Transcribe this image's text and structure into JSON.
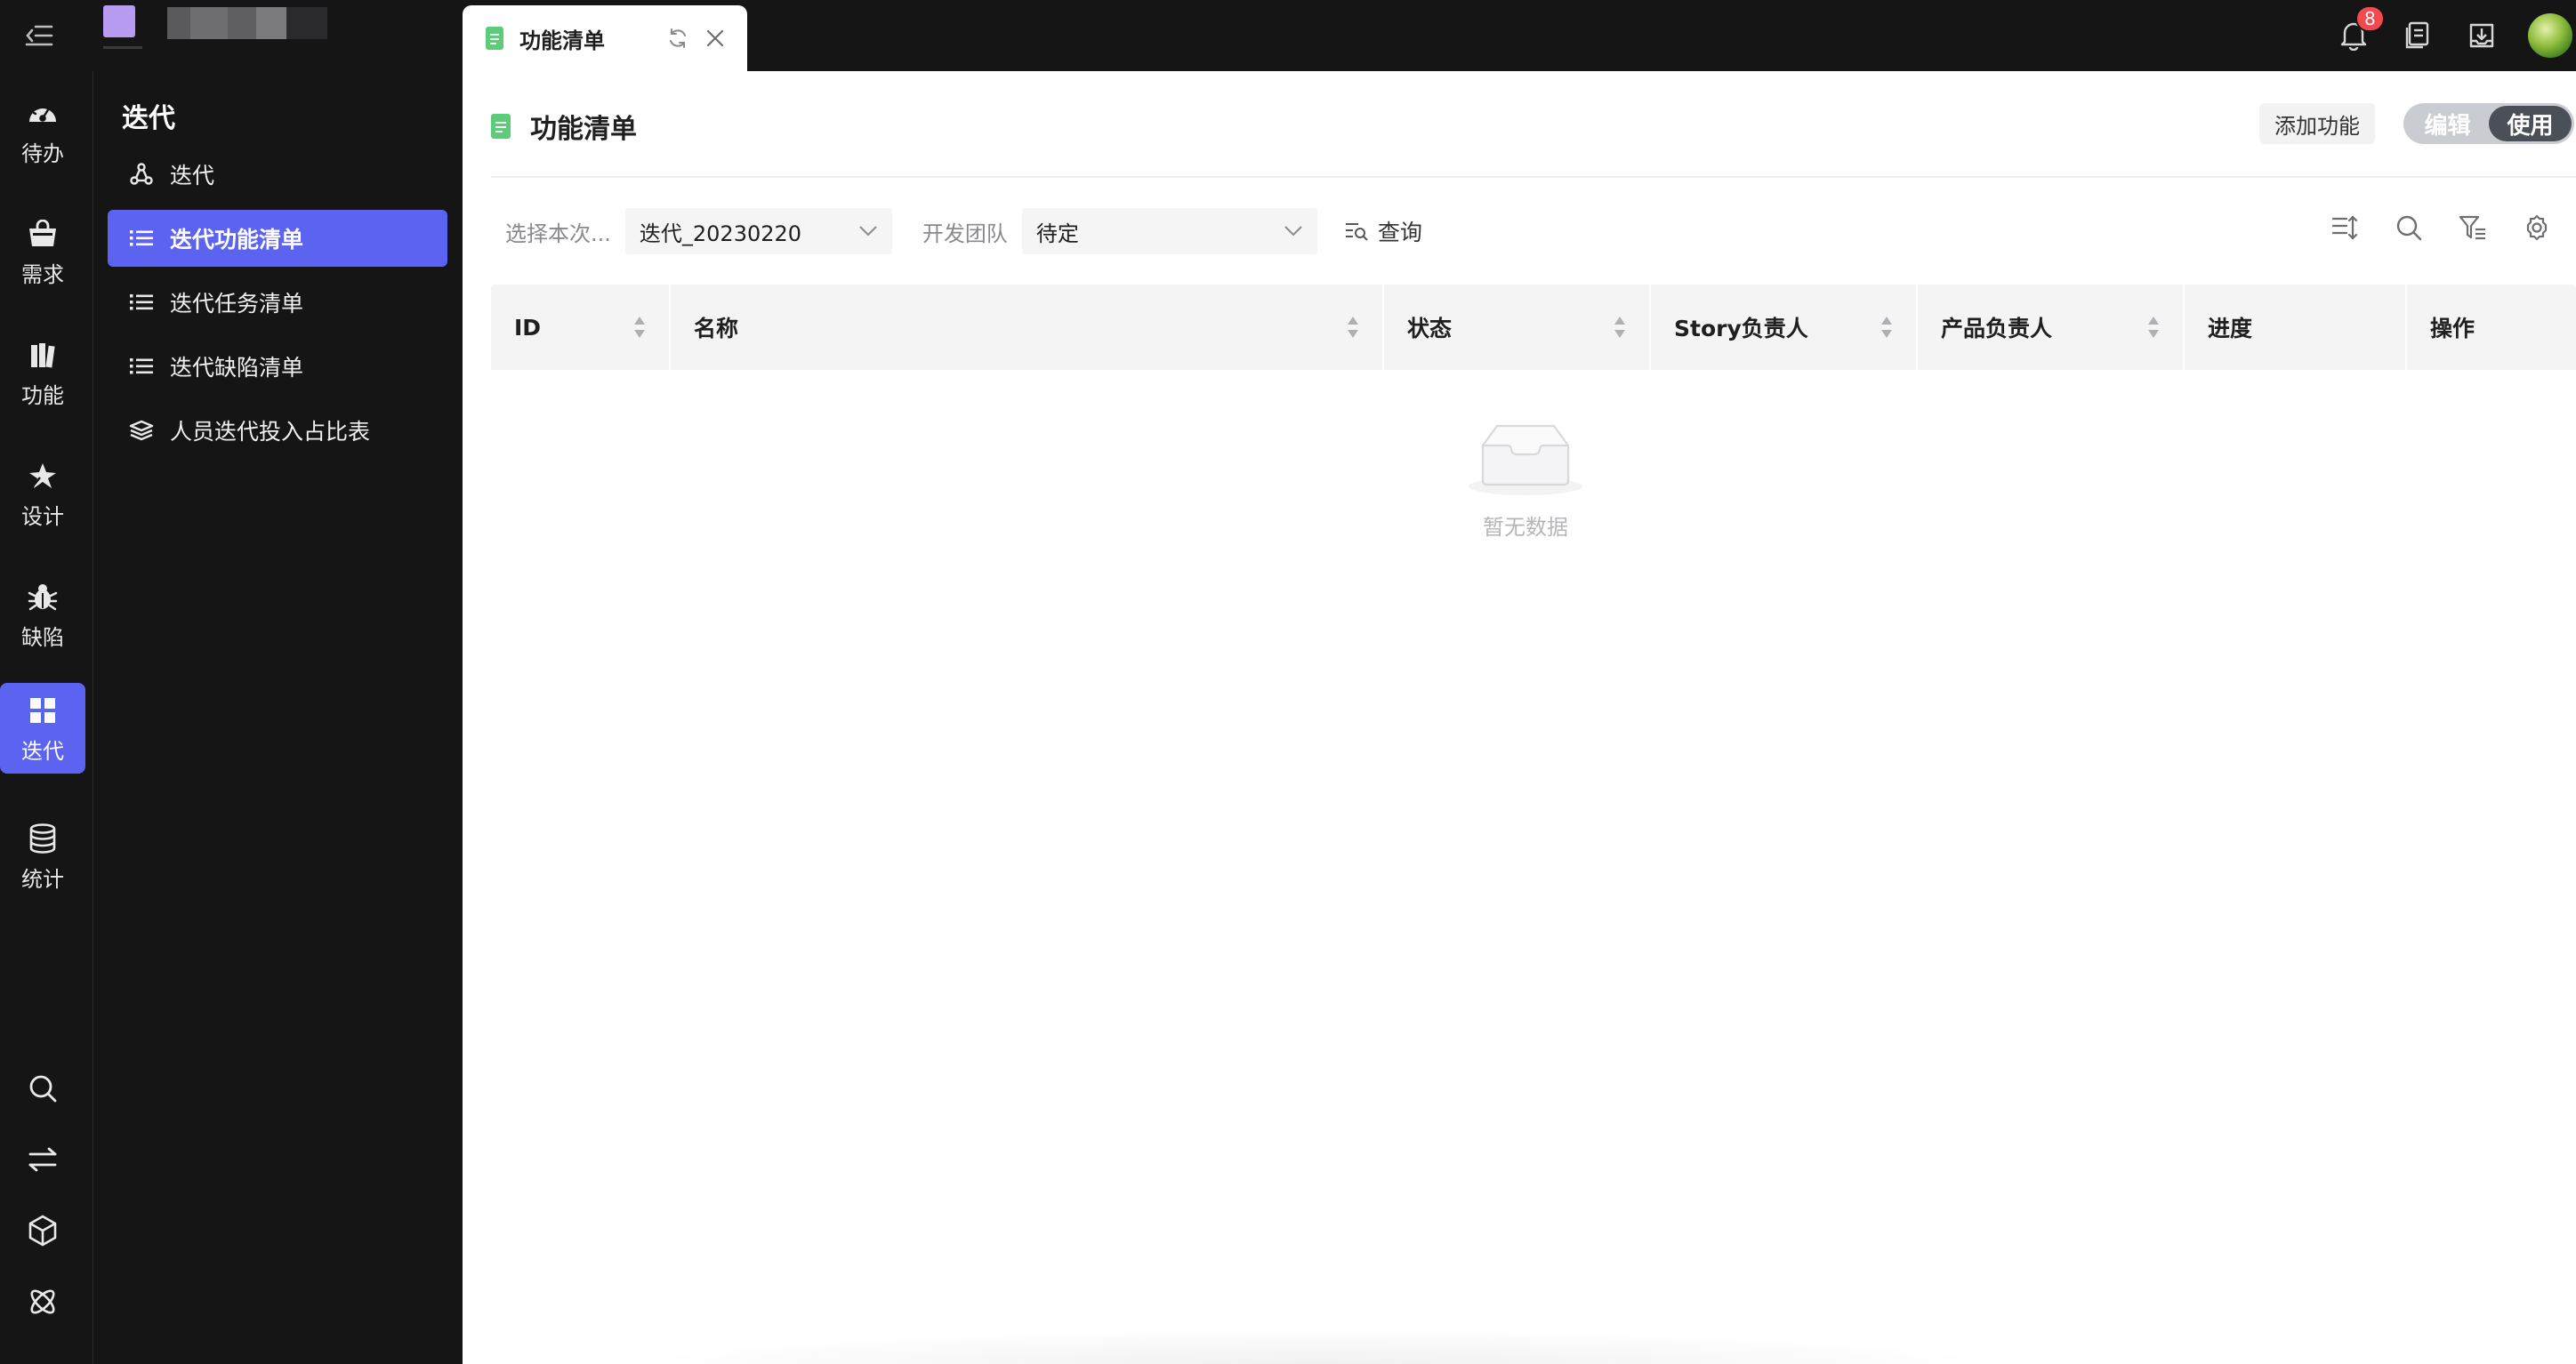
{
  "app": {
    "logo_color": "#b89cf2"
  },
  "topbar": {
    "tab_title": "功能清单",
    "notification_count": "8",
    "icons": [
      "bell-icon",
      "document-icon",
      "inbox-download-icon",
      "avatar"
    ]
  },
  "rail": {
    "items": [
      {
        "label": "待办",
        "icon": "dashboard-icon"
      },
      {
        "label": "需求",
        "icon": "bag-icon"
      },
      {
        "label": "功能",
        "icon": "books-icon"
      },
      {
        "label": "设计",
        "icon": "design-icon"
      },
      {
        "label": "缺陷",
        "icon": "bug-icon"
      },
      {
        "label": "迭代",
        "icon": "grid-icon",
        "active": true
      },
      {
        "label": "统计",
        "icon": "database-icon"
      }
    ],
    "bottom_icons": [
      "search-icon",
      "switch-icon",
      "cube-icon",
      "atom-icon"
    ]
  },
  "submenu": {
    "title": "迭代",
    "items": [
      {
        "label": "迭代",
        "icon": "branch-icon"
      },
      {
        "label": "迭代功能清单",
        "icon": "list-icon",
        "active": true
      },
      {
        "label": "迭代任务清单",
        "icon": "list-icon"
      },
      {
        "label": "迭代缺陷清单",
        "icon": "list-icon"
      },
      {
        "label": "人员迭代投入占比表",
        "icon": "layers-icon"
      }
    ]
  },
  "page": {
    "title": "功能清单",
    "add_button": "添加功能",
    "toggle": {
      "edit": "编辑",
      "use": "使用",
      "selected": "使用"
    }
  },
  "filters": {
    "iteration_label": "选择本次...",
    "iteration_value": "迭代_20230220",
    "team_label": "开发团队",
    "team_value": "待定",
    "query_label": "查询"
  },
  "table": {
    "columns": [
      {
        "label": "ID",
        "sortable": true
      },
      {
        "label": "名称",
        "sortable": true
      },
      {
        "label": "状态",
        "sortable": true
      },
      {
        "label": "Story负责人",
        "sortable": true
      },
      {
        "label": "产品负责人",
        "sortable": true
      },
      {
        "label": "进度",
        "sortable": false
      },
      {
        "label": "操作",
        "sortable": false
      }
    ],
    "rows": [],
    "empty_text": "暂无数据"
  },
  "colors": {
    "accent": "#5b63f0",
    "sidebar_bg": "#151516",
    "badge": "#f5484f"
  }
}
